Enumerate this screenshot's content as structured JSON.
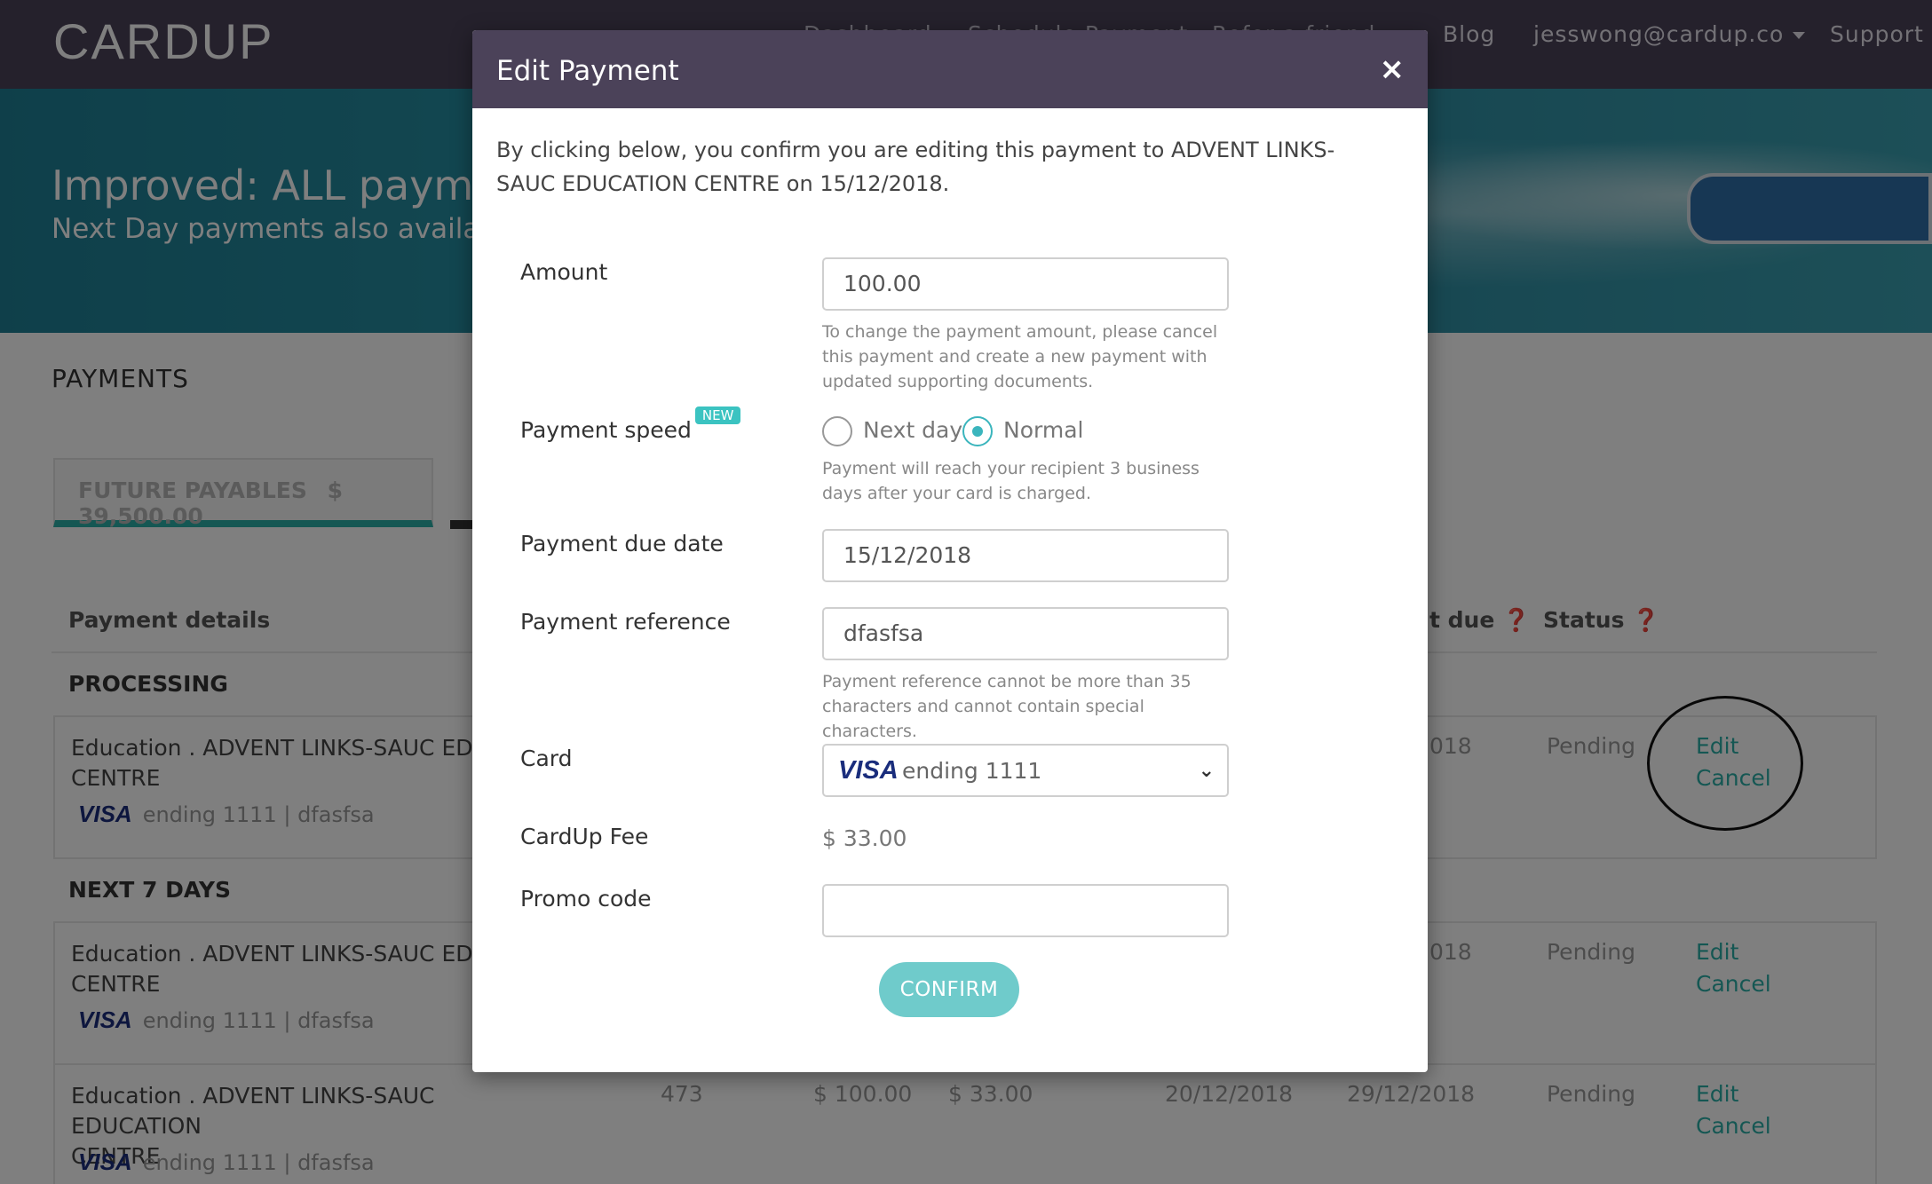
{
  "nav": {
    "logo": "CARDUP",
    "hidden_links": [
      "Dashboard",
      "Schedule Payment",
      "Refer a friend"
    ],
    "blog": "Blog",
    "account": "jesswong@cardup.co",
    "support": "Support"
  },
  "hero": {
    "title": "Improved: ALL payments",
    "subtitle": "Next Day payments also available"
  },
  "page": {
    "title": "PAYMENTS",
    "tab_label": "FUTURE PAYABLES",
    "tab_amount": "$ 39,500.00"
  },
  "table": {
    "headers": {
      "details": "Payment details",
      "due": "t due",
      "status": "Status"
    },
    "sections": {
      "processing": "PROCESSING",
      "next7": "NEXT 7 DAYS"
    },
    "rows": [
      {
        "name": "Education . ADVENT LINKS-SAUC EDUC",
        "name2": "CENTRE",
        "card_brand": "VISA",
        "card_info": "ending 1111 | dfasfsa",
        "due": "018",
        "status": "Pending",
        "edit": "Edit",
        "cancel": "Cancel"
      },
      {
        "name": "Education . ADVENT LINKS-SAUC EDUC",
        "name2": "CENTRE",
        "card_brand": "VISA",
        "card_info": "ending 1111 | dfasfsa",
        "due": "018",
        "status": "Pending",
        "edit": "Edit",
        "cancel": "Cancel"
      },
      {
        "name": "Education . ADVENT LINKS-SAUC EDUCATION",
        "name2": "CENTRE",
        "card_brand": "VISA",
        "card_info": "ending 1111 | dfasfsa",
        "id": "473",
        "amount": "$ 100.00",
        "fee": "$ 33.00",
        "charge_date": "20/12/2018",
        "due": "29/12/2018",
        "status": "Pending",
        "edit": "Edit",
        "cancel": "Cancel"
      }
    ]
  },
  "modal": {
    "title": "Edit Payment",
    "close": "×",
    "intro": "By clicking below, you confirm you are editing this payment to ADVENT LINKS-SAUC EDUCATION CENTRE on 15/12/2018.",
    "amount_label": "Amount",
    "amount_value": "100.00",
    "amount_help": "To change the payment amount, please cancel this payment and create a new payment with updated supporting documents.",
    "speed_label": "Payment speed",
    "new_badge": "NEW",
    "speed_next_day": "Next day",
    "speed_normal": "Normal",
    "speed_selected": "Normal",
    "speed_help": "Payment will reach your recipient 3 business days after your card is charged.",
    "due_label": "Payment due date",
    "due_value": "15/12/2018",
    "ref_label": "Payment reference",
    "ref_value": "dfasfsa",
    "ref_help": "Payment reference cannot be more than 35 characters and cannot contain special characters.",
    "card_label": "Card",
    "card_brand": "VISA",
    "card_value": "ending 1111",
    "fee_label": "CardUp Fee",
    "fee_value": "$ 33.00",
    "promo_label": "Promo code",
    "promo_value": "",
    "confirm": "CONFIRM"
  },
  "colors": {
    "brand_purple": "#4b4259",
    "accent_teal": "#2aaea6",
    "confirm_teal": "#6fcbcb",
    "visa_blue": "#1a2d7c"
  }
}
